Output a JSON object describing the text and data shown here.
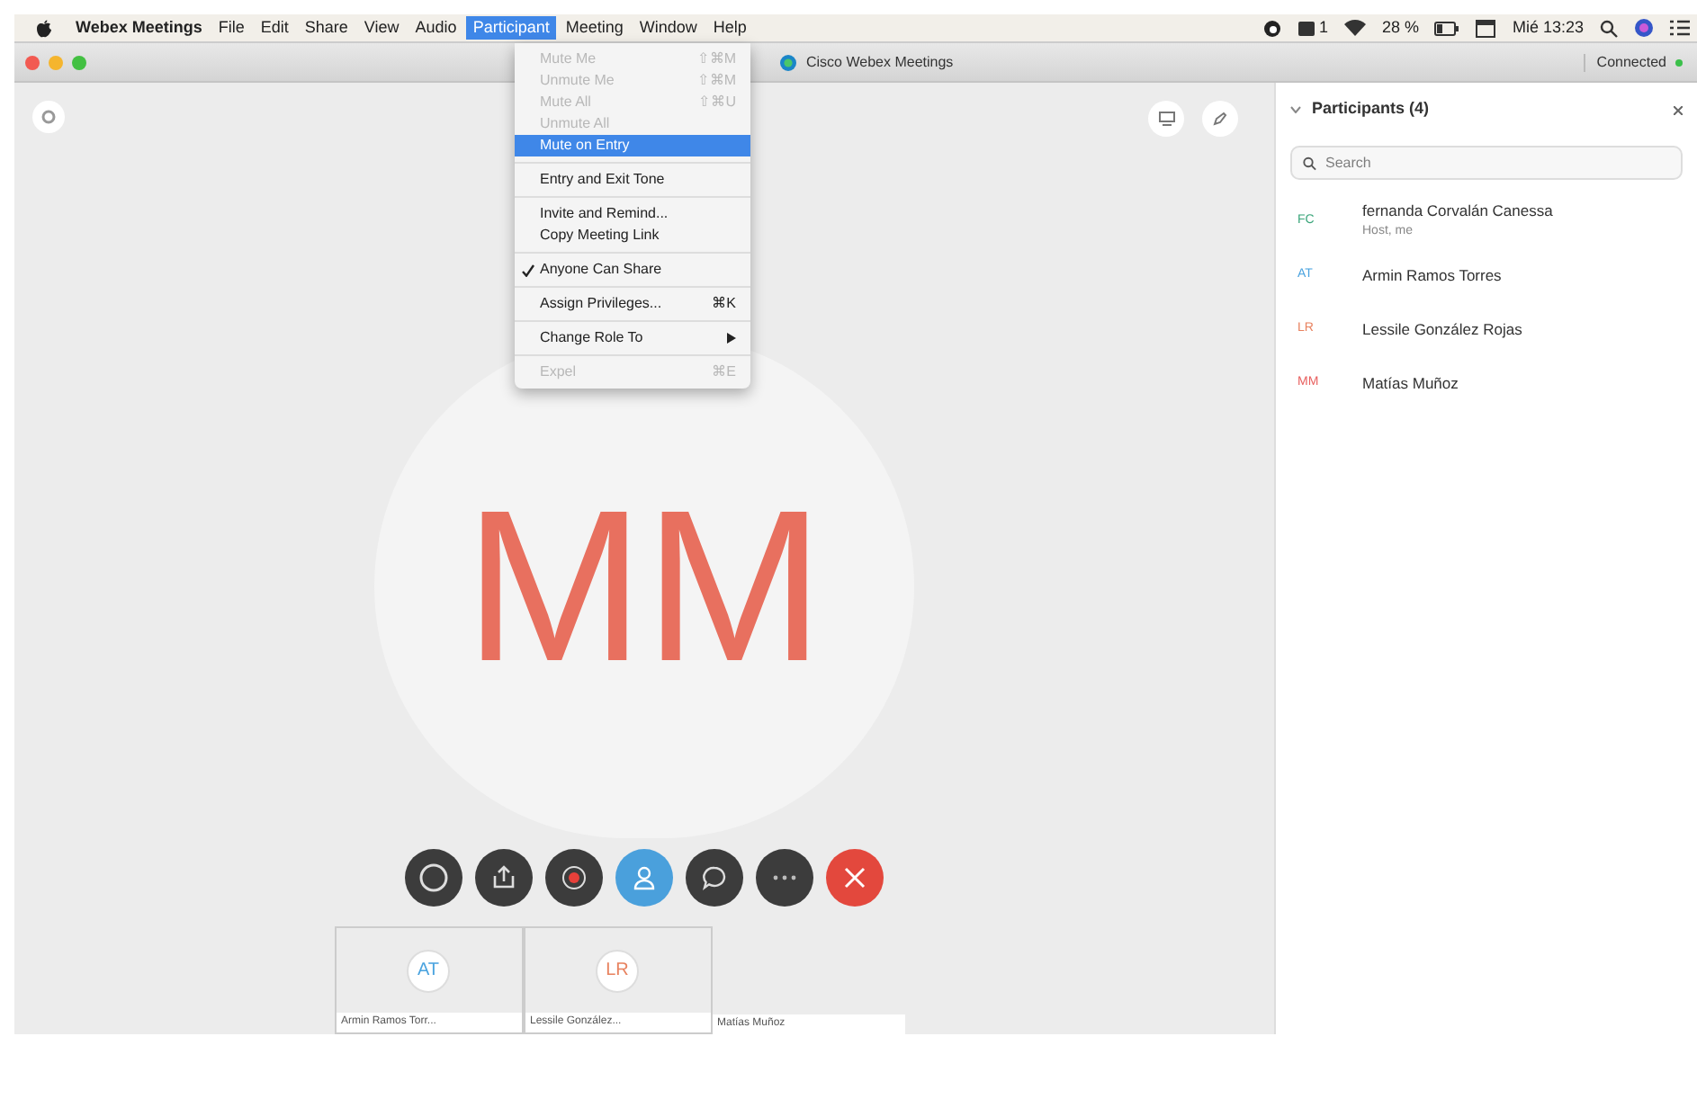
{
  "menubar": {
    "app": "Webex Meetings",
    "items": [
      {
        "label": "File",
        "selected": false
      },
      {
        "label": "Edit",
        "selected": false
      },
      {
        "label": "Share",
        "selected": false
      },
      {
        "label": "View",
        "selected": false
      },
      {
        "label": "Audio",
        "selected": false
      },
      {
        "label": "Participant",
        "selected": true
      },
      {
        "label": "Meeting",
        "selected": false
      },
      {
        "label": "Window",
        "selected": false
      },
      {
        "label": "Help",
        "selected": false
      }
    ],
    "badge_count": "1",
    "battery": "28 %",
    "clock": "Mié 13:23"
  },
  "window": {
    "title": "Cisco Webex Meetings",
    "status": "Connected"
  },
  "menu": {
    "groups": [
      [
        {
          "label": "Mute Me",
          "shortcut": "⇧⌘M",
          "disabled": true,
          "selected": false,
          "checked": false,
          "submenu": false
        },
        {
          "label": "Unmute Me",
          "shortcut": "⇧⌘M",
          "disabled": true,
          "selected": false,
          "checked": false,
          "submenu": false
        },
        {
          "label": "Mute All",
          "shortcut": "⇧⌘U",
          "disabled": true,
          "selected": false,
          "checked": false,
          "submenu": false
        },
        {
          "label": "Unmute All",
          "disabled": true,
          "selected": false,
          "checked": false,
          "submenu": false
        },
        {
          "label": "Mute on Entry",
          "disabled": false,
          "selected": true,
          "checked": false,
          "submenu": false
        }
      ],
      [
        {
          "label": "Entry and Exit Tone",
          "disabled": false,
          "selected": false,
          "checked": false,
          "submenu": false
        }
      ],
      [
        {
          "label": "Invite and Remind...",
          "disabled": false,
          "selected": false,
          "checked": false,
          "submenu": false
        },
        {
          "label": "Copy Meeting Link",
          "disabled": false,
          "selected": false,
          "checked": false,
          "submenu": false
        }
      ],
      [
        {
          "label": "Anyone Can Share",
          "disabled": false,
          "selected": false,
          "checked": true,
          "submenu": false
        }
      ],
      [
        {
          "label": "Assign Privileges...",
          "shortcut": "⌘K",
          "disabled": false,
          "selected": false,
          "checked": false,
          "submenu": false
        }
      ],
      [
        {
          "label": "Change Role To",
          "disabled": false,
          "selected": false,
          "checked": false,
          "submenu": true
        }
      ],
      [
        {
          "label": "Expel",
          "shortcut": "⌘E",
          "disabled": true,
          "selected": false,
          "checked": false,
          "submenu": false
        }
      ]
    ]
  },
  "stage": {
    "initials": "MM",
    "color": "#e8705f"
  },
  "controls": [
    {
      "kind": "audio",
      "selected": false
    },
    {
      "kind": "share",
      "selected": false
    },
    {
      "kind": "record",
      "selected": false
    },
    {
      "kind": "participants",
      "selected": true
    },
    {
      "kind": "chat",
      "selected": false
    },
    {
      "kind": "more",
      "selected": false
    },
    {
      "kind": "leave",
      "selected": false
    }
  ],
  "thumbnails": [
    {
      "kind": "tile",
      "initials": "AT",
      "name": "Armin Ramos Torr...",
      "color": "#4aa3df"
    },
    {
      "kind": "tile",
      "initials": "LR",
      "name": "Lessile González...",
      "color": "#e8825f"
    },
    {
      "kind": "label",
      "name": "Matías Muñoz"
    }
  ],
  "panel": {
    "title": "Participants (4)",
    "search": {
      "placeholder": "Search"
    },
    "participants": [
      {
        "initials": "FC",
        "name": "fernanda Corvalán Canessa",
        "role": "Host, me",
        "color": "#3aa57a"
      },
      {
        "initials": "AT",
        "name": "Armin Ramos Torres",
        "color": "#4aa3df"
      },
      {
        "initials": "LR",
        "name": "Lessile González Rojas",
        "color": "#e8825f"
      },
      {
        "initials": "MM",
        "name": "Matías Muñoz",
        "color": "#e8605f"
      }
    ]
  }
}
